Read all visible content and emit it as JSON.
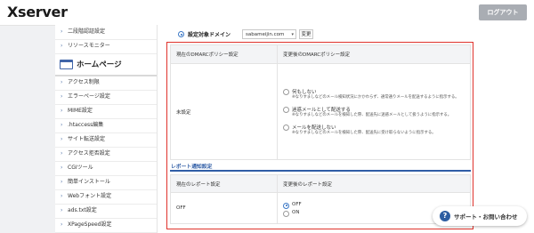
{
  "header": {
    "logo": "Xserver",
    "logout_label": "ログアウト"
  },
  "sidebar": {
    "items_top": [
      {
        "label": "二段階認証設定"
      },
      {
        "label": "リソースモニター"
      }
    ],
    "section_title": "ホームページ",
    "items": [
      {
        "label": "アクセス制限"
      },
      {
        "label": "エラーページ設定"
      },
      {
        "label": "MIME設定"
      },
      {
        "label": ".htaccess編集"
      },
      {
        "label": "サイト転送設定"
      },
      {
        "label": "アクセス拒否設定"
      },
      {
        "label": "CGIツール"
      },
      {
        "label": "簡単インストール"
      },
      {
        "label": "Webフォント設定"
      },
      {
        "label": "ads.txt設定"
      },
      {
        "label": "XPageSpeed設定"
      }
    ]
  },
  "domain_bar": {
    "label": "設定対象ドメイン",
    "selected_domain": "sabameijin.com",
    "change_label": "変更"
  },
  "dmarc_table": {
    "col_current": "現在のDMARCポリシー設定",
    "col_new": "変更後のDMARCポリシー設定",
    "current_value": "未設定",
    "options": [
      {
        "label": "何もしない",
        "desc": "※なりすましなどのメール検知状況にかかわらず、通常通りメールを配送するように指示する。",
        "selected": false
      },
      {
        "label": "迷惑メールとして配送する",
        "desc": "※なりすましなどのメールを検知した際、配送先に迷惑メールとして扱うように指示する。",
        "selected": false
      },
      {
        "label": "メールを配送しない",
        "desc": "※なりすましなどのメールを検知した際、配送先に受け取らないように指示する。",
        "selected": false
      }
    ]
  },
  "report_section": {
    "title": "レポート通知設定"
  },
  "report_table": {
    "col_current": "現在のレポート設定",
    "col_new": "変更後のレポート設定",
    "current_value": "OFF",
    "options": [
      {
        "label": "OFF",
        "selected": true
      },
      {
        "label": "ON",
        "selected": false
      }
    ]
  },
  "support": {
    "icon": "question-icon",
    "label": "サポート・お問い合わせ"
  },
  "colors": {
    "highlight_border": "#e0332c",
    "accent_blue": "#2f5da6",
    "logout_bg": "#a9adb3"
  }
}
